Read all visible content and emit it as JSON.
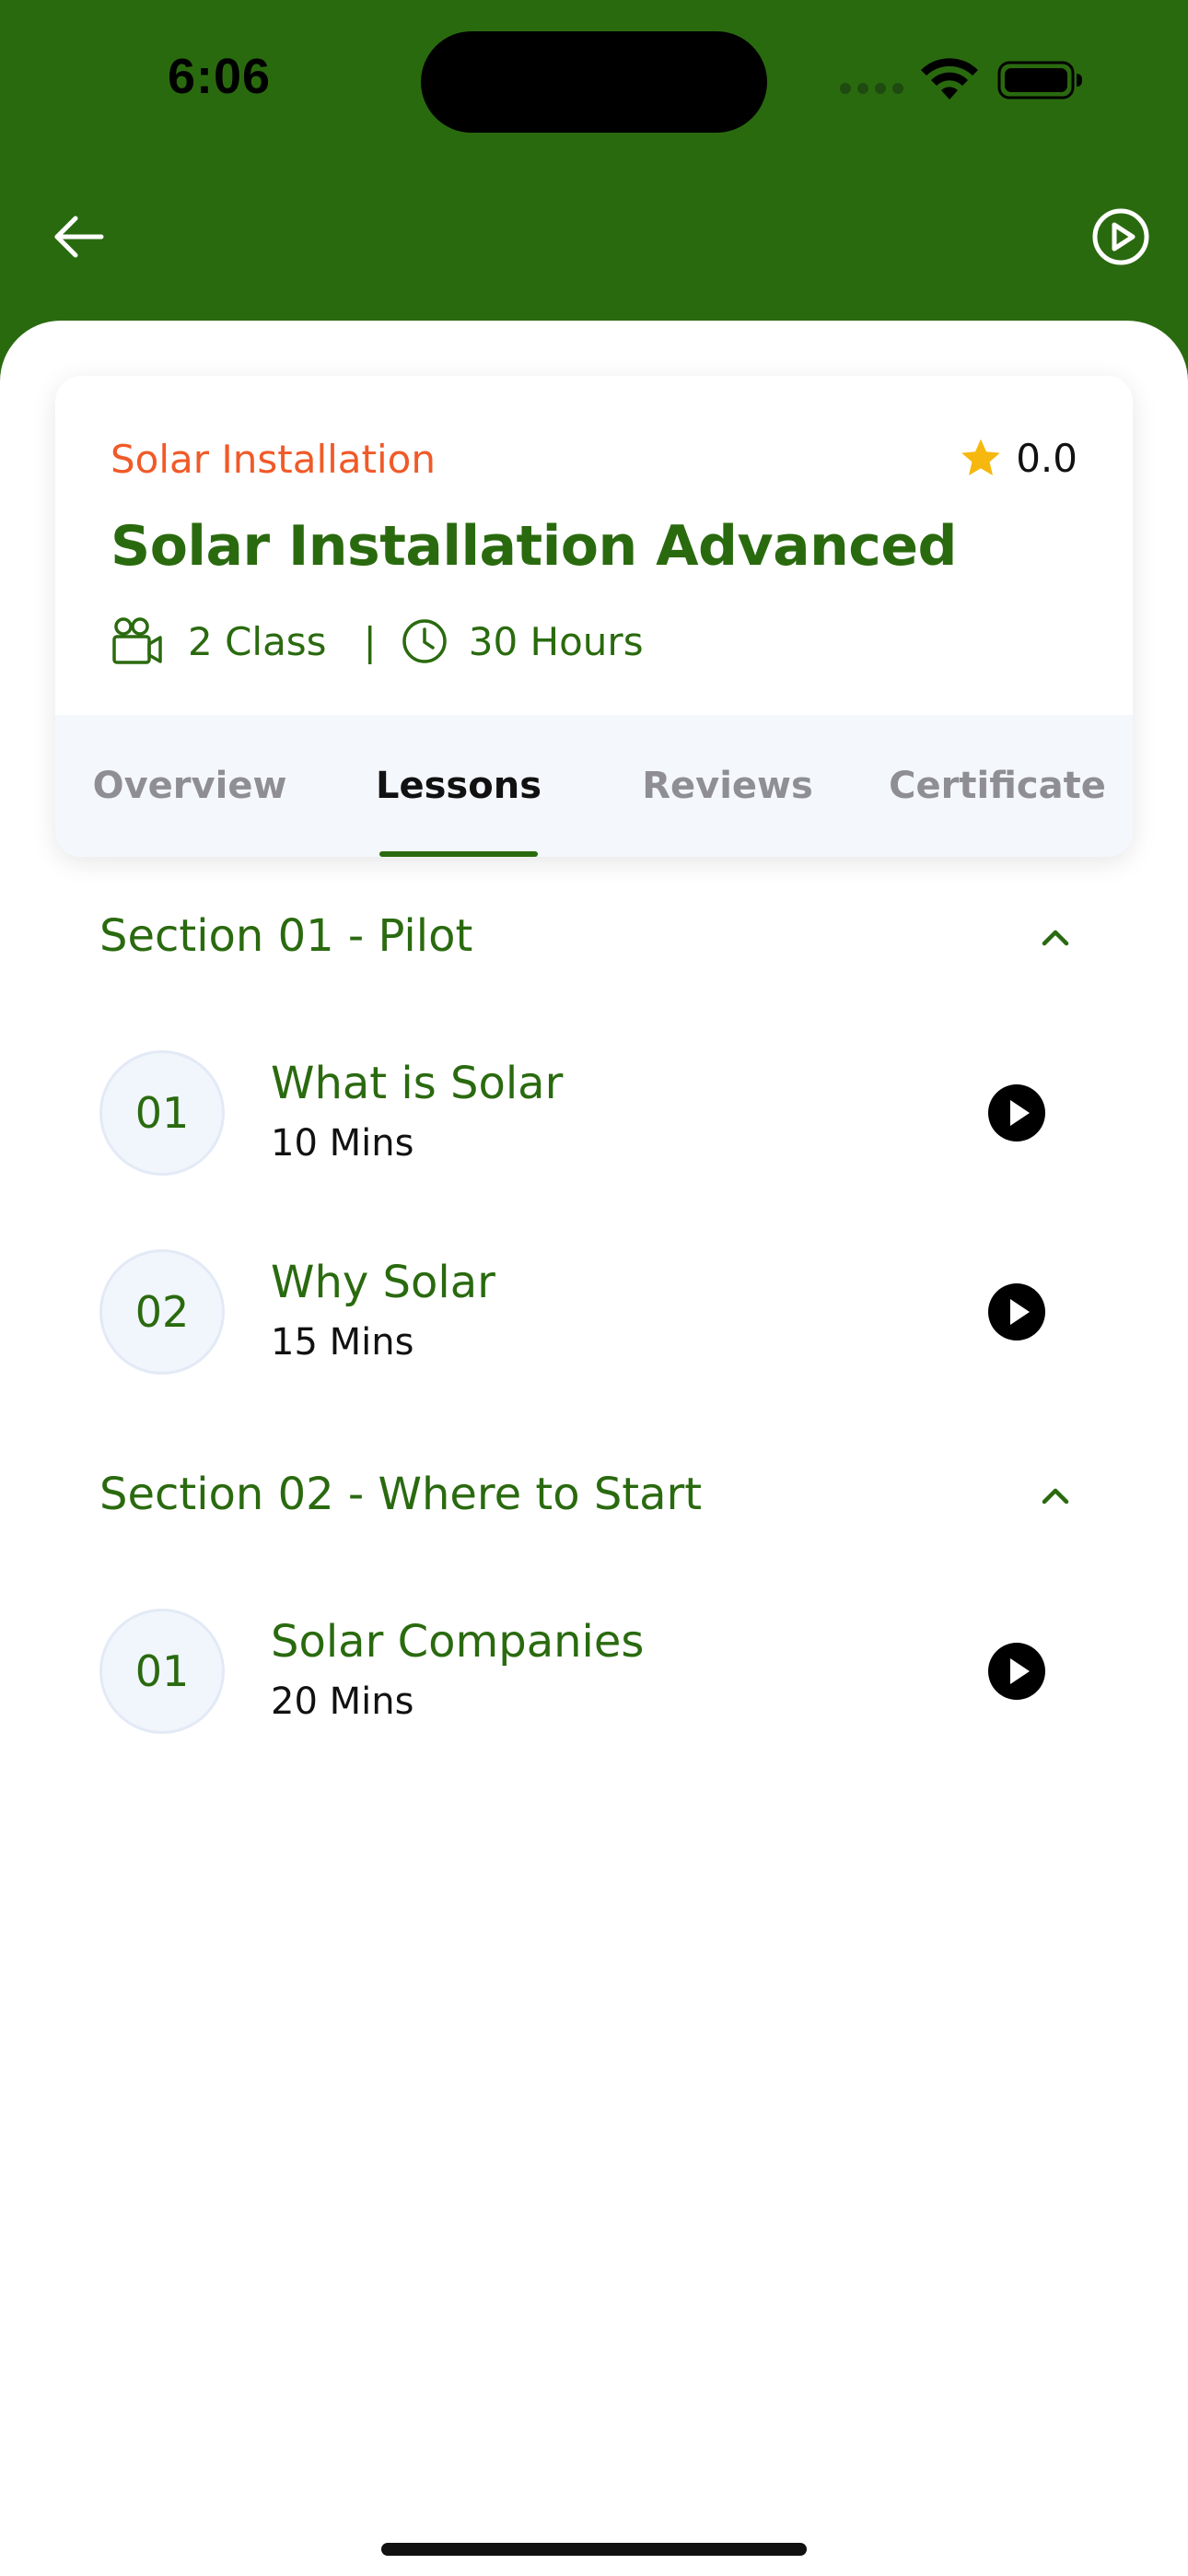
{
  "status_bar": {
    "time": "6:06"
  },
  "colors": {
    "brand_green": "#2a6a0f",
    "accent_orange": "#f05a28",
    "star": "#f6b80e"
  },
  "app_bar": {
    "back_icon": "arrow-left-icon",
    "action_icon": "play-circle-icon"
  },
  "course": {
    "category": "Solar Installation",
    "rating": "0.0",
    "title": "Solar Installation Advanced",
    "classes": "2 Class",
    "separator": "|",
    "hours": "30 Hours"
  },
  "tabs": [
    {
      "label": "Overview",
      "active": false
    },
    {
      "label": "Lessons",
      "active": true
    },
    {
      "label": "Reviews",
      "active": false
    },
    {
      "label": "Certificate",
      "active": false
    }
  ],
  "sections": [
    {
      "title": "Section 01 - Pilot",
      "expanded": true,
      "lessons": [
        {
          "number": "01",
          "title": "What is Solar",
          "duration": "10 Mins"
        },
        {
          "number": "02",
          "title": "Why Solar",
          "duration": "15 Mins"
        }
      ]
    },
    {
      "title": "Section 02 - Where to Start",
      "expanded": true,
      "lessons": [
        {
          "number": "01",
          "title": "Solar Companies",
          "duration": "20 Mins"
        }
      ]
    }
  ]
}
